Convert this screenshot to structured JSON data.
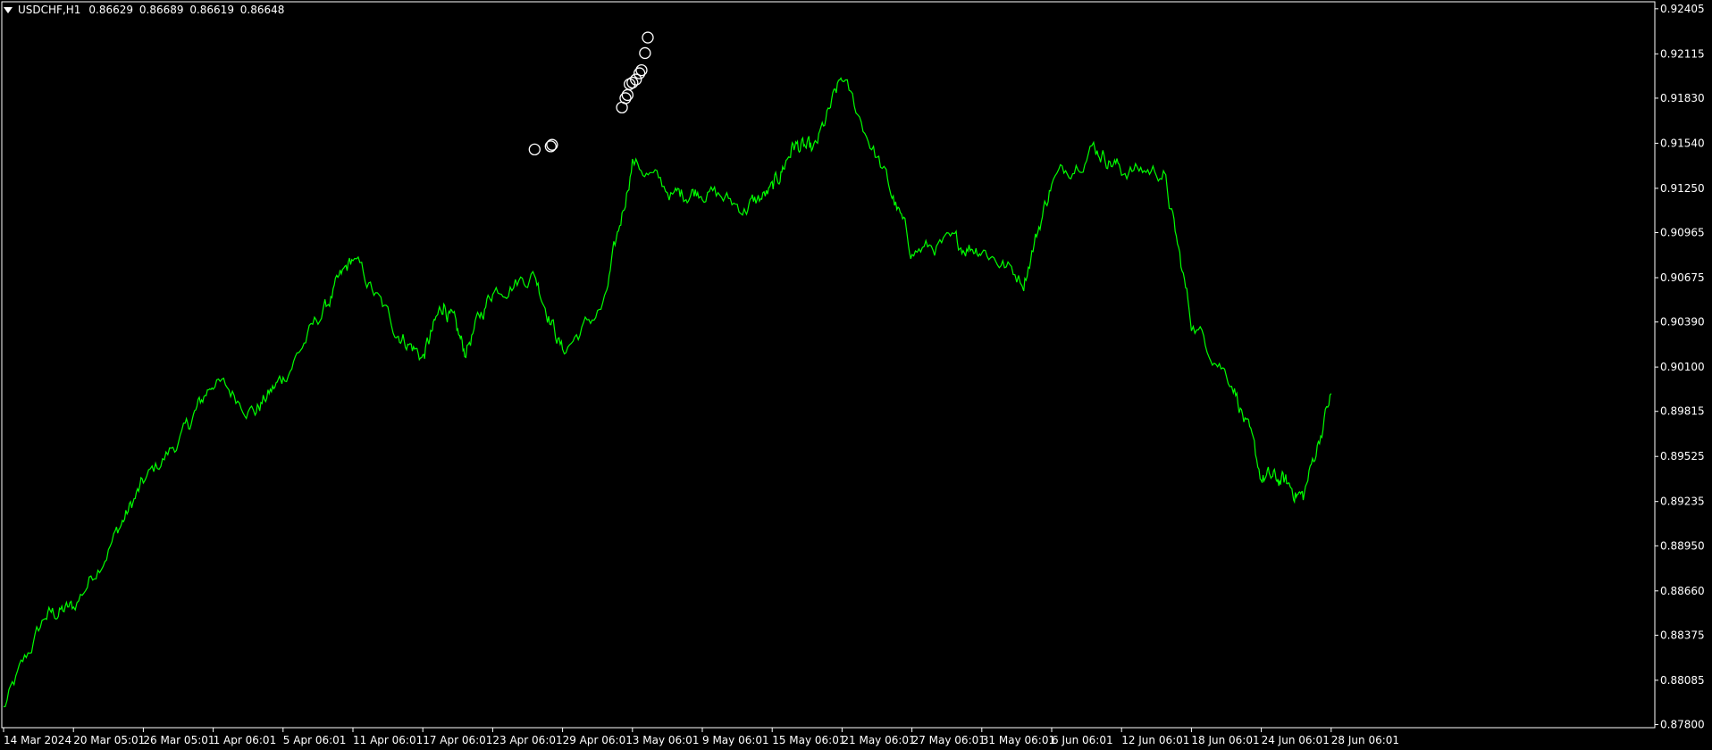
{
  "window": {
    "symbol": "USDCHF,H1",
    "ohlc": [
      "0.86629",
      "0.86689",
      "0.86619",
      "0.86648"
    ]
  },
  "colors": {
    "background": "#000000",
    "price_line": "#00ff00",
    "axis": "#ffffff",
    "markers": "#ffffff"
  },
  "chart_data": {
    "type": "line",
    "title": "USDCHF,H1",
    "yticks": [
      "0.92405",
      "0.92115",
      "0.91830",
      "0.91540",
      "0.91250",
      "0.90965",
      "0.90675",
      "0.90390",
      "0.90100",
      "0.89815",
      "0.89525",
      "0.89235",
      "0.88950",
      "0.88660",
      "0.88375",
      "0.88085",
      "0.87800"
    ],
    "xticks": [
      "14 Mar 2024",
      "20 Mar 05:01",
      "26 Mar 05:01",
      "1 Apr 06:01",
      "5 Apr 06:01",
      "11 Apr 06:01",
      "17 Apr 06:01",
      "23 Apr 06:01",
      "29 Apr 06:01",
      "3 May 06:01",
      "9 May 06:01",
      "15 May 06:01",
      "21 May 06:01",
      "27 May 06:01",
      "31 May 06:01",
      "6 Jun 06:01",
      "12 Jun 06:01",
      "18 Jun 06:01",
      "24 Jun 06:01",
      "28 Jun 06:01"
    ],
    "ylim": [
      0.8778,
      0.9245
    ],
    "series": [
      {
        "x": [
          0,
          0.6,
          1,
          1.6,
          2,
          2.6,
          3,
          3.6,
          4,
          4.6,
          5,
          5.6,
          6,
          6.3,
          6.6,
          7,
          7.6,
          8,
          8.6,
          9,
          9.6,
          10,
          10.6,
          11,
          11.3,
          11.6,
          12,
          12.6,
          13,
          13.6,
          14,
          14.6,
          15,
          15.6,
          16,
          16.6,
          17,
          17.6,
          18,
          18.3,
          18.6,
          19
        ],
        "y": [
          0.879,
          0.885,
          0.8855,
          0.8902,
          0.8935,
          0.8968,
          0.9002,
          0.8982,
          0.9003,
          0.9048,
          0.908,
          0.9035,
          0.9016,
          0.9052,
          0.902,
          0.906,
          0.907,
          0.902,
          0.905,
          0.9143,
          0.912,
          0.9125,
          0.9112,
          0.9123,
          0.9153,
          0.9148,
          0.9196,
          0.9135,
          0.9085,
          0.9089,
          0.9087,
          0.9066,
          0.9129,
          0.9152,
          0.9137,
          0.9136,
          0.904,
          0.9,
          0.8939,
          0.8937,
          0.8926,
          0.8993
        ]
      }
    ],
    "highlighted_points": [
      {
        "x": 7.6,
        "y": 0.915
      },
      {
        "x": 7.83,
        "y": 0.9152
      },
      {
        "x": 7.85,
        "y": 0.9153
      },
      {
        "x": 8.85,
        "y": 0.9177
      },
      {
        "x": 8.9,
        "y": 0.9183
      },
      {
        "x": 8.93,
        "y": 0.9185
      },
      {
        "x": 8.96,
        "y": 0.9192
      },
      {
        "x": 9.0,
        "y": 0.9193
      },
      {
        "x": 9.05,
        "y": 0.9195
      },
      {
        "x": 9.1,
        "y": 0.9199
      },
      {
        "x": 9.13,
        "y": 0.9201
      },
      {
        "x": 9.18,
        "y": 0.9212
      },
      {
        "x": 9.22,
        "y": 0.9222
      }
    ]
  }
}
